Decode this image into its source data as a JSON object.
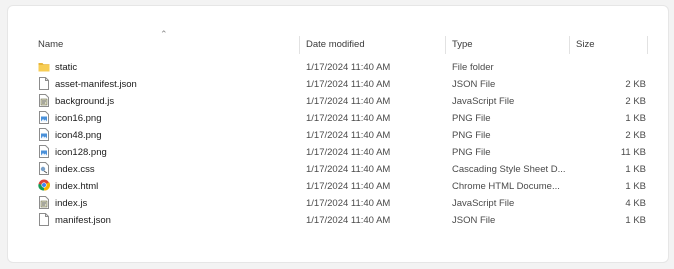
{
  "columns": {
    "name": "Name",
    "date": "Date modified",
    "type": "Type",
    "size": "Size"
  },
  "files": [
    {
      "name": "static",
      "date": "1/17/2024 11:40 AM",
      "type": "File folder",
      "size": "",
      "icon": "folder-icon"
    },
    {
      "name": "asset-manifest.json",
      "date": "1/17/2024 11:40 AM",
      "type": "JSON File",
      "size": "2 KB",
      "icon": "blank-file-icon"
    },
    {
      "name": "background.js",
      "date": "1/17/2024 11:40 AM",
      "type": "JavaScript File",
      "size": "2 KB",
      "icon": "script-file-icon"
    },
    {
      "name": "icon16.png",
      "date": "1/17/2024 11:40 AM",
      "type": "PNG File",
      "size": "1 KB",
      "icon": "image-file-icon"
    },
    {
      "name": "icon48.png",
      "date": "1/17/2024 11:40 AM",
      "type": "PNG File",
      "size": "2 KB",
      "icon": "image-file-icon"
    },
    {
      "name": "icon128.png",
      "date": "1/17/2024 11:40 AM",
      "type": "PNG File",
      "size": "11 KB",
      "icon": "image-file-icon"
    },
    {
      "name": "index.css",
      "date": "1/17/2024 11:40 AM",
      "type": "Cascading Style Sheet D...",
      "size": "1 KB",
      "icon": "css-file-icon"
    },
    {
      "name": "index.html",
      "date": "1/17/2024 11:40 AM",
      "type": "Chrome HTML Docume...",
      "size": "1 KB",
      "icon": "chrome-icon"
    },
    {
      "name": "index.js",
      "date": "1/17/2024 11:40 AM",
      "type": "JavaScript File",
      "size": "4 KB",
      "icon": "script-file-icon"
    },
    {
      "name": "manifest.json",
      "date": "1/17/2024 11:40 AM",
      "type": "JSON File",
      "size": "1 KB",
      "icon": "blank-file-icon"
    }
  ]
}
